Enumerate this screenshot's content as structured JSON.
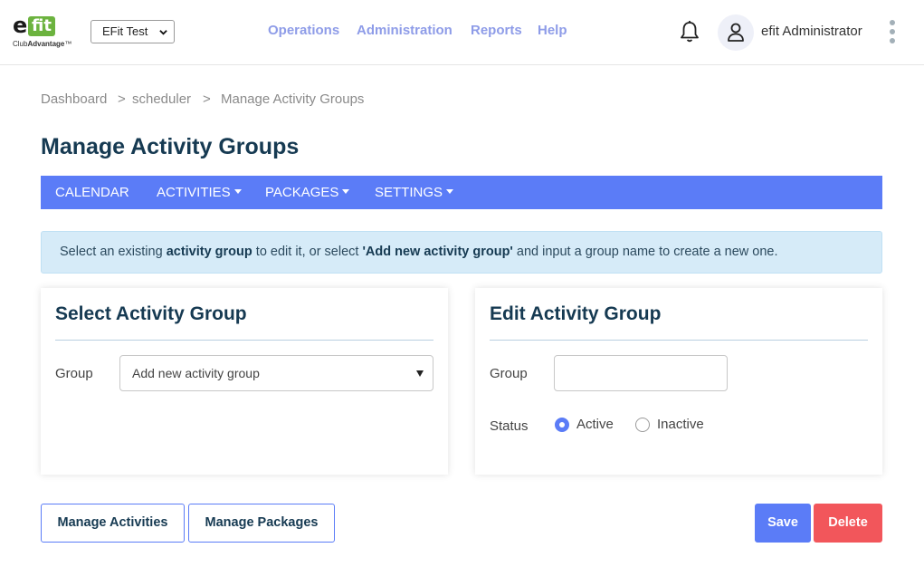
{
  "header": {
    "logo_letter": "e",
    "logo_mark": "fit",
    "logo_sub_prefix": "Club",
    "logo_sub_brand": "Advantage",
    "logo_sub_tm": "™",
    "club_select_value": "EFit Test",
    "nav": [
      "Operations",
      "Administration",
      "Reports",
      "Help"
    ],
    "username": "efit Administrator",
    "icons": {
      "notifications": "bell-icon",
      "avatar": "user-icon",
      "more": "kebab-menu-icon"
    }
  },
  "breadcrumb": {
    "items": [
      "Dashboard",
      "scheduler",
      "Manage Activity Groups"
    ],
    "separator": ">"
  },
  "page": {
    "title": "Manage Activity Groups"
  },
  "subnav": {
    "items": [
      {
        "label": "CALENDAR",
        "has_dropdown": false
      },
      {
        "label": "ACTIVITIES",
        "has_dropdown": true
      },
      {
        "label": "PACKAGES",
        "has_dropdown": true
      },
      {
        "label": "SETTINGS",
        "has_dropdown": true
      }
    ]
  },
  "alert": {
    "part1": "Select an existing ",
    "bold1": "activity group",
    "part2": " to edit it, or select ",
    "bold2": "'Add new activity group'",
    "part3": " and input a group name to create a new one."
  },
  "select_card": {
    "title": "Select Activity Group",
    "group_label": "Group",
    "group_value": "Add new activity group"
  },
  "edit_card": {
    "title": "Edit Activity Group",
    "group_label": "Group",
    "group_value": "",
    "status_label": "Status",
    "status_options": [
      "Active",
      "Inactive"
    ],
    "status_selected": "Active"
  },
  "actions": {
    "manage_activities": "Manage Activities",
    "manage_packages": "Manage Packages",
    "save": "Save",
    "delete": "Delete"
  },
  "colors": {
    "accent": "#5b7cf7",
    "nav_text": "#8e9ce8",
    "title": "#163a52",
    "alert_bg": "#d6ebf8",
    "danger": "#f2565b",
    "logo_green": "#6cb33f"
  }
}
